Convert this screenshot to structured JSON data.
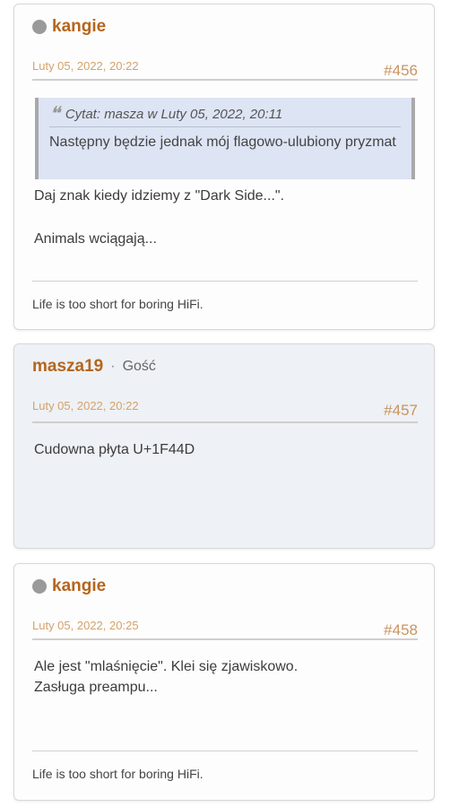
{
  "posts": [
    {
      "username": "kangie",
      "date": "Luty 05, 2022, 20:22",
      "number": "#456",
      "quote": {
        "header": "Cytat: masza w Luty 05, 2022, 20:11",
        "text": "Następny będzie jednak mój flagowo-ulubiony pryzmat"
      },
      "body": [
        "Daj znak kiedy idziemy z \"Dark Side...\".",
        "Animals wciągają..."
      ],
      "signature": "Life is too short for boring HiFi."
    },
    {
      "username": "masza19",
      "separator": "·",
      "role": "Gość",
      "date": "Luty 05, 2022, 20:22",
      "number": "#457",
      "body": [
        "Cudowna płyta  U+1F44D"
      ]
    },
    {
      "username": "kangie",
      "date": "Luty 05, 2022, 20:25",
      "number": "#458",
      "body": [
        "Ale jest \"mlaśnięcie\". Klei się zjawiskowo.",
        "Zasługa preampu..."
      ],
      "signature": "Life is too short for boring HiFi."
    }
  ],
  "icons": {
    "status": "offline-status-icon",
    "quote": "quote-icon"
  },
  "colors": {
    "username": "#b5651d",
    "date": "#d4a26a",
    "quote_bg": "#dde4f4",
    "guest_bg": "#eef1f5"
  }
}
